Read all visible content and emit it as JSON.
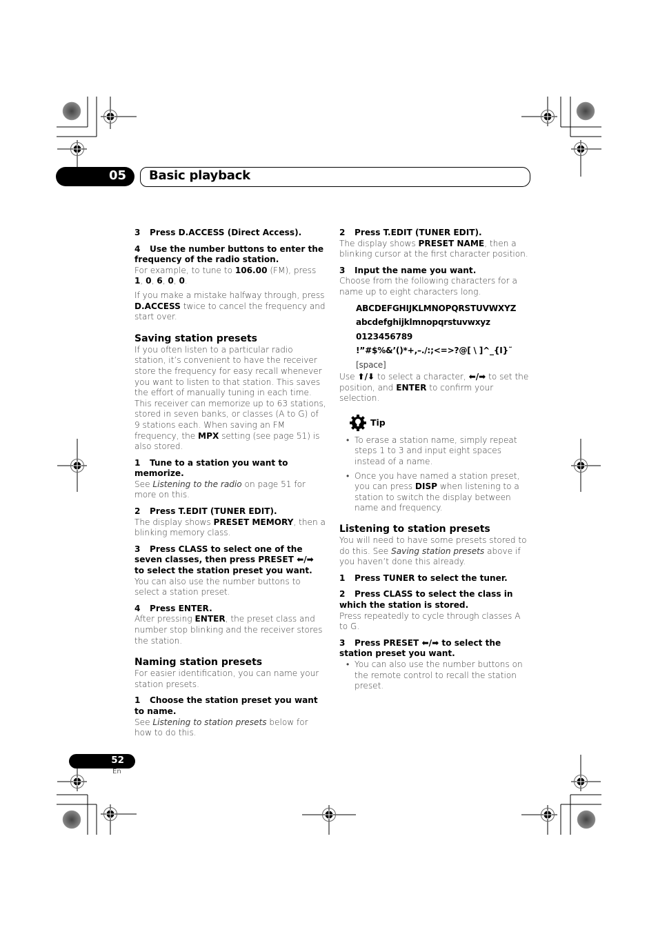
{
  "header": {
    "chapter_number": "05",
    "chapter_title": "Basic playback"
  },
  "left_column": {
    "step3_num": "3",
    "step3_text": "Press D.ACCESS (Direct Access).",
    "step4_num": "4",
    "step4_text": "Use the number buttons to enter the frequency of the radio station.",
    "step4_p1_a": "For example, to tune to ",
    "step4_p1_b": "106.00",
    "step4_p1_c": " (FM), press ",
    "step4_p1_d": "1",
    "step4_p1_e": ", ",
    "step4_p1_f": "0",
    "step4_p1_g": ", ",
    "step4_p1_h": "6",
    "step4_p1_i": ", ",
    "step4_p1_j": "0",
    "step4_p1_k": ", ",
    "step4_p1_l": "0",
    "step4_p1_m": ".",
    "step4_p2_a": "If you make a mistake halfway through, press ",
    "step4_p2_b": "D.ACCESS",
    "step4_p2_c": " twice to cancel the frequency and start over.",
    "saving": {
      "heading": "Saving station presets",
      "intro_a": "If you often listen to a particular radio station, it’s convenient to have the receiver store the frequency for easy recall whenever you want to listen to that station. This saves the effort of manually tuning in each time. This receiver can memorize up to 63 stations, stored in seven banks, or classes (A to G) of 9 stations each. When saving an FM frequency, the ",
      "intro_b": "MPX",
      "intro_c": " setting (see page 51) is also stored.",
      "s1_num": "1",
      "s1_text": "Tune to a station you want to memorize.",
      "s1_p_a": "See ",
      "s1_p_b": "Listening to the radio",
      "s1_p_c": " on page 51 for more on this.",
      "s2_num": "2",
      "s2_text": "Press T.EDIT (TUNER EDIT).",
      "s2_p_a": "The display shows ",
      "s2_p_b": "PRESET MEMORY",
      "s2_p_c": ", then a blinking memory class.",
      "s3_num": "3",
      "s3_text_a": "Press CLASS to select one of the seven classes, then press PRESET ",
      "s3_arrows": "⬅/➡",
      "s3_text_b": " to select the station preset you want.",
      "s3_p": "You can also use the number buttons to select a station preset.",
      "s4_num": "4",
      "s4_text": "Press ENTER.",
      "s4_p_a": "After pressing ",
      "s4_p_b": "ENTER",
      "s4_p_c": ", the preset class and number stop blinking and the receiver stores the station."
    },
    "naming": {
      "heading": "Naming station presets",
      "intro": "For easier identification, you can name your station presets.",
      "s1_num": "1",
      "s1_text": "Choose the station preset you want to name.",
      "s1_p_a": "See ",
      "s1_p_b": "Listening to station presets",
      "s1_p_c": " below for how to do this."
    }
  },
  "right_column": {
    "s2_num": "2",
    "s2_text": "Press T.EDIT (TUNER EDIT).",
    "s2_p_a": "The display shows ",
    "s2_p_b": "PRESET NAME",
    "s2_p_c": ", then a blinking cursor at the first character position.",
    "s3_num": "3",
    "s3_text": "Input the name you want.",
    "s3_p": "Choose from the following characters for a name up to eight characters long.",
    "charset": {
      "upper": "ABCDEFGHIJKLMNOPQRSTUVWXYZ",
      "lower": "abcdefghijklmnopqrstuvwxyz",
      "digits": "0123456789",
      "symbols": "!”#$%&’()*+,–./:;<=>?@[ \\ ]^_{I}˜",
      "space_label": " [space]"
    },
    "use_a": "Use ",
    "use_updown": "⬆/⬇",
    "use_b": " to select a character, ",
    "use_leftright": "⬅/➡",
    "use_c": " to set the position, and ",
    "use_d": "ENTER",
    "use_e": " to confirm your selection.",
    "tip": {
      "label": "Tip",
      "items": [
        {
          "text": "To erase a station name, simply repeat steps 1 to 3 and input eight spaces instead of a name."
        },
        {
          "text_a": "Once you have named a station preset, you can press ",
          "text_b": "DISP",
          "text_c": " when listening to a station to switch the display between name and frequency."
        }
      ]
    },
    "listening": {
      "heading": "Listening to station presets",
      "intro_a": "You will need to have some presets stored to do this. See ",
      "intro_b": "Saving station presets",
      "intro_c": " above if you haven’t done this already.",
      "s1_num": "1",
      "s1_text": "Press TUNER to select the tuner.",
      "s2_num": "2",
      "s2_text": "Press CLASS to select the class in which the station is stored.",
      "s2_p": "Press repeatedly to cycle through classes A to G.",
      "s3_num": "3",
      "s3_text_a": "Press PRESET ",
      "s3_arrows": "⬅/➡",
      "s3_text_b": " to select the station preset you want.",
      "s3_bullet": "You can also use the number buttons on the remote control to recall the station preset."
    }
  },
  "footer": {
    "page_number": "52",
    "language": "En"
  }
}
